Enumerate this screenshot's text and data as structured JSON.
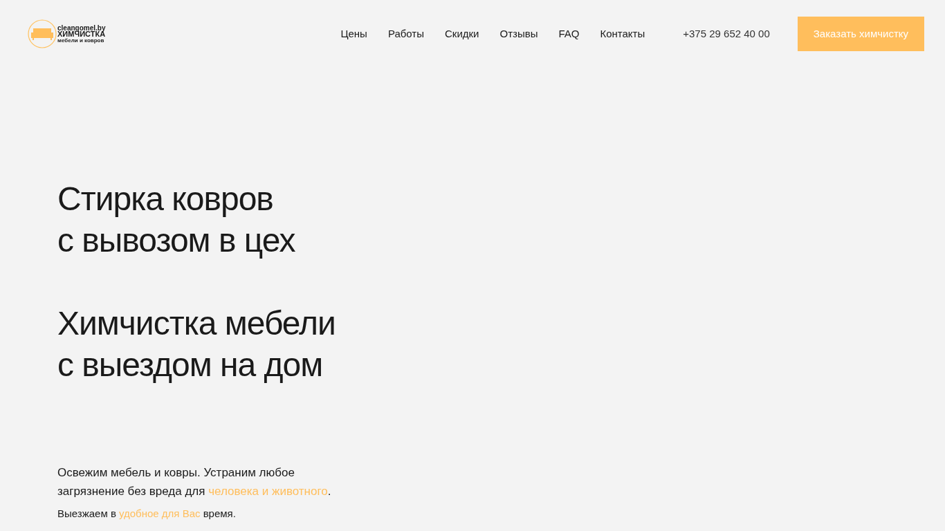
{
  "logo": {
    "site": "cleangomel.by",
    "title": "ХИМЧИСТКА",
    "subtitle": "мебели и ковров"
  },
  "nav": [
    "Цены",
    "Работы",
    "Скидки",
    "Отзывы",
    "FAQ",
    "Контакты"
  ],
  "phone": "+375 29 652 40 00",
  "cta": "Заказать химчистку",
  "headings": [
    [
      "Стирка ковров",
      "с вывозом в цех"
    ],
    [
      "Химчистка мебели",
      "с выездом на дом"
    ]
  ],
  "paragraphs": [
    {
      "kind": "large",
      "segments": [
        {
          "text": "Освежим мебель и ковры. Устраним любое загрязнение без вреда для ",
          "highlight": false
        },
        {
          "text": "человека и животного",
          "highlight": true
        },
        {
          "text": ".",
          "highlight": false
        }
      ]
    },
    {
      "kind": "small",
      "segments": [
        {
          "text": "Выезжаем в ",
          "highlight": false
        },
        {
          "text": "удобное для Вас",
          "highlight": true
        },
        {
          "text": " время.",
          "highlight": false
        }
      ]
    }
  ]
}
